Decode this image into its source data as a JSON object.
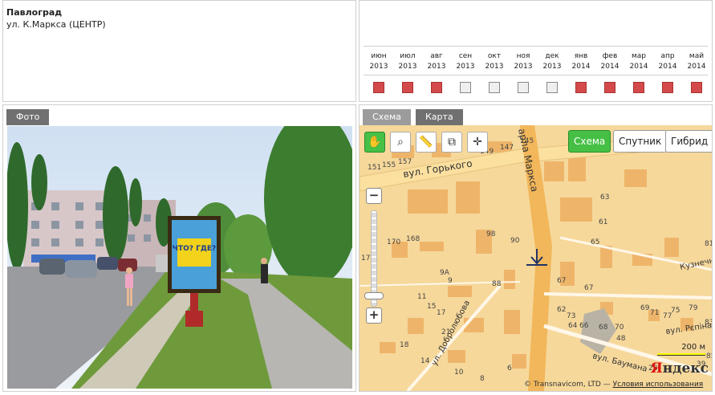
{
  "info": {
    "city": "Павлоград",
    "address": "ул. К.Маркса (ЦЕНТР)"
  },
  "calendar": {
    "months": [
      {
        "m": "июн",
        "y": "2013",
        "status": "busy"
      },
      {
        "m": "июл",
        "y": "2013",
        "status": "busy"
      },
      {
        "m": "авг",
        "y": "2013",
        "status": "busy"
      },
      {
        "m": "сен",
        "y": "2013",
        "status": "free"
      },
      {
        "m": "окт",
        "y": "2013",
        "status": "free"
      },
      {
        "m": "ноя",
        "y": "2013",
        "status": "free"
      },
      {
        "m": "дек",
        "y": "2013",
        "status": "free"
      },
      {
        "m": "янв",
        "y": "2014",
        "status": "busy"
      },
      {
        "m": "фев",
        "y": "2014",
        "status": "busy"
      },
      {
        "m": "мар",
        "y": "2014",
        "status": "busy"
      },
      {
        "m": "апр",
        "y": "2014",
        "status": "busy"
      },
      {
        "m": "май",
        "y": "2014",
        "status": "busy"
      }
    ],
    "colors": {
      "busy": "#d44a4a",
      "free": "#efefef"
    }
  },
  "photo": {
    "tab": "Фото",
    "billboard_text": "ЧТО? ГДЕ?"
  },
  "map": {
    "tabs": [
      "Схема",
      "Карта"
    ],
    "type_buttons": [
      "Схема",
      "Спутник",
      "Гибрид"
    ],
    "tools": [
      "hand-icon",
      "zoom-area-icon",
      "ruler-icon",
      "layers-icon",
      "center-icon"
    ],
    "zoom_in": "+",
    "zoom_out": "−",
    "streets": {
      "gorkogo": "вул. Горького",
      "marksa": "арла Маркса",
      "dobrolyubova": "ул. Добролюбова",
      "kuznech": "Кузнечн",
      "repina": "вул. Рєпіна",
      "baumana": "вул. Баумана"
    },
    "house_numbers": [
      "149",
      "147",
      "145",
      "151",
      "155",
      "157",
      "63",
      "67",
      "81",
      "98",
      "90",
      "88",
      "170",
      "168",
      "176",
      "65",
      "61",
      "9А",
      "9",
      "11",
      "15",
      "17",
      "73",
      "67",
      "62",
      "64",
      "66",
      "68",
      "70",
      "48",
      "69",
      "71",
      "77",
      "75",
      "79",
      "83",
      "85",
      "39",
      "28",
      "21",
      "18",
      "14",
      "10",
      "8",
      "6"
    ],
    "scale": "200 м",
    "copyright": "© Transnavicom, LTD —",
    "terms": "Условия использования",
    "logo": "Яндекс"
  }
}
